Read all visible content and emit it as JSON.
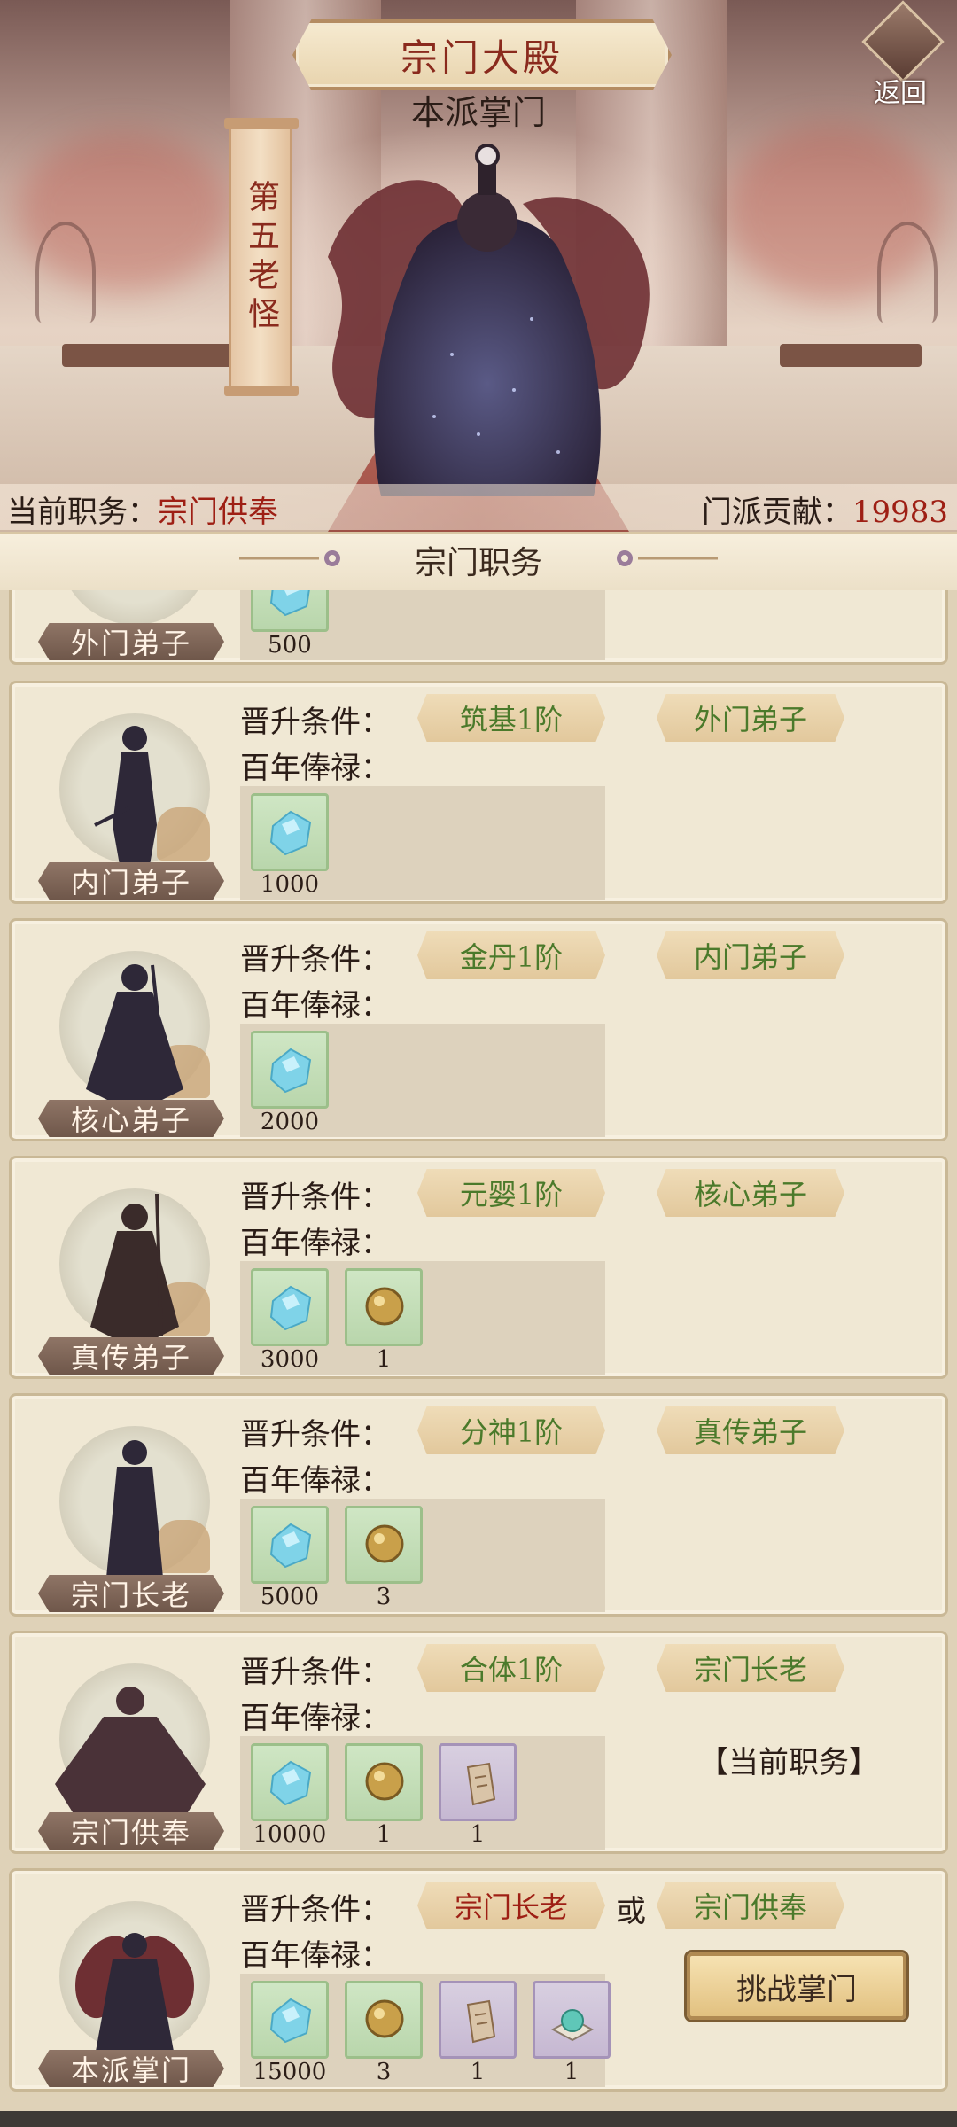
{
  "header": {
    "title": "宗门大殿",
    "back_label": "返回",
    "subtitle": "本派掌门",
    "banner_text": "第五老怪"
  },
  "status_bar": {
    "position_label": "当前职务：",
    "position_value": "宗门供奉",
    "contribution_label": "门派贡献：",
    "contribution_value": "19983"
  },
  "section": {
    "title": "宗门职务"
  },
  "labels": {
    "condition": "晋升条件：",
    "salary": "百年俸禄：",
    "or": "或",
    "current_status": "【当前职务】",
    "challenge": "挑战掌门"
  },
  "colors": {
    "accent_red": "#9e1f14",
    "accent_green": "#4b7a2b"
  },
  "ranks": [
    {
      "name": "外门弟子",
      "rewards": [
        {
          "icon": "spirit-stone-icon",
          "qty": "500"
        }
      ]
    },
    {
      "name": "内门弟子",
      "req1": "筑基1阶",
      "req2": "外门弟子",
      "rewards": [
        {
          "icon": "spirit-stone-icon",
          "qty": "1000"
        }
      ]
    },
    {
      "name": "核心弟子",
      "req1": "金丹1阶",
      "req2": "内门弟子",
      "rewards": [
        {
          "icon": "spirit-stone-icon",
          "qty": "2000"
        }
      ]
    },
    {
      "name": "真传弟子",
      "req1": "元婴1阶",
      "req2": "核心弟子",
      "rewards": [
        {
          "icon": "spirit-stone-icon",
          "qty": "3000"
        },
        {
          "icon": "golden-orb-icon",
          "qty": "1"
        }
      ]
    },
    {
      "name": "宗门长老",
      "req1": "分神1阶",
      "req2": "真传弟子",
      "rewards": [
        {
          "icon": "spirit-stone-icon",
          "qty": "5000"
        },
        {
          "icon": "golden-orb-icon",
          "qty": "3"
        }
      ]
    },
    {
      "name": "宗门供奉",
      "req1": "合体1阶",
      "req2": "宗门长老",
      "rewards": [
        {
          "icon": "spirit-stone-icon",
          "qty": "10000"
        },
        {
          "icon": "golden-orb-icon",
          "qty": "1"
        },
        {
          "icon": "token-icon",
          "qty": "1"
        }
      ]
    },
    {
      "name": "本派掌门",
      "req1": "宗门长老",
      "req2": "宗门供奉",
      "rewards": [
        {
          "icon": "spirit-stone-icon",
          "qty": "15000"
        },
        {
          "icon": "golden-orb-icon",
          "qty": "3"
        },
        {
          "icon": "token-icon",
          "qty": "1"
        },
        {
          "icon": "jade-pearl-icon",
          "qty": "1"
        }
      ]
    }
  ]
}
